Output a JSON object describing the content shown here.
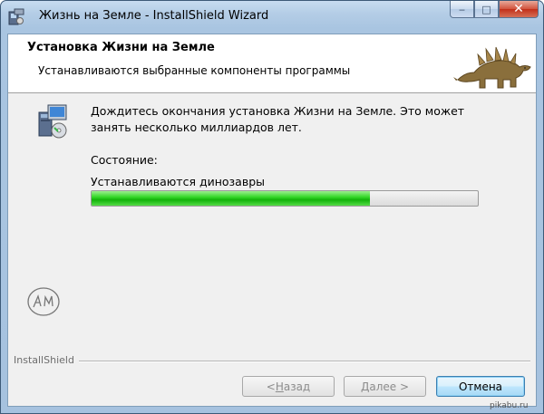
{
  "window": {
    "title": "Жизнь на Земле - InstallShield Wizard",
    "caption_buttons": {
      "minimize": "‒",
      "maximize": "□",
      "close": "✕"
    }
  },
  "banner": {
    "title": "Установка Жизни на Земле",
    "subtitle": "Устанавливаются выбранные компоненты программы"
  },
  "content": {
    "message": "Дождитесь окончания установка Жизни на Земле. Это может занять несколько миллиардов лет.",
    "status_label": "Состояние:",
    "status_value": "Устанавливаются динозавры",
    "progress": 0.72,
    "progress_color": "#22c418"
  },
  "footer": {
    "brand": "InstallShield",
    "back_prefix": "< ",
    "back_key": "Н",
    "back_rest": "азад",
    "next_key": "Д",
    "next_rest": "алее >",
    "cancel": "Отмена"
  },
  "watermark": "pikabu.ru",
  "icons": {
    "app": "installer-icon",
    "content": "installer-computer-icon",
    "banner": "stegosaurus-image",
    "stamp": "handwritten-stamp"
  }
}
